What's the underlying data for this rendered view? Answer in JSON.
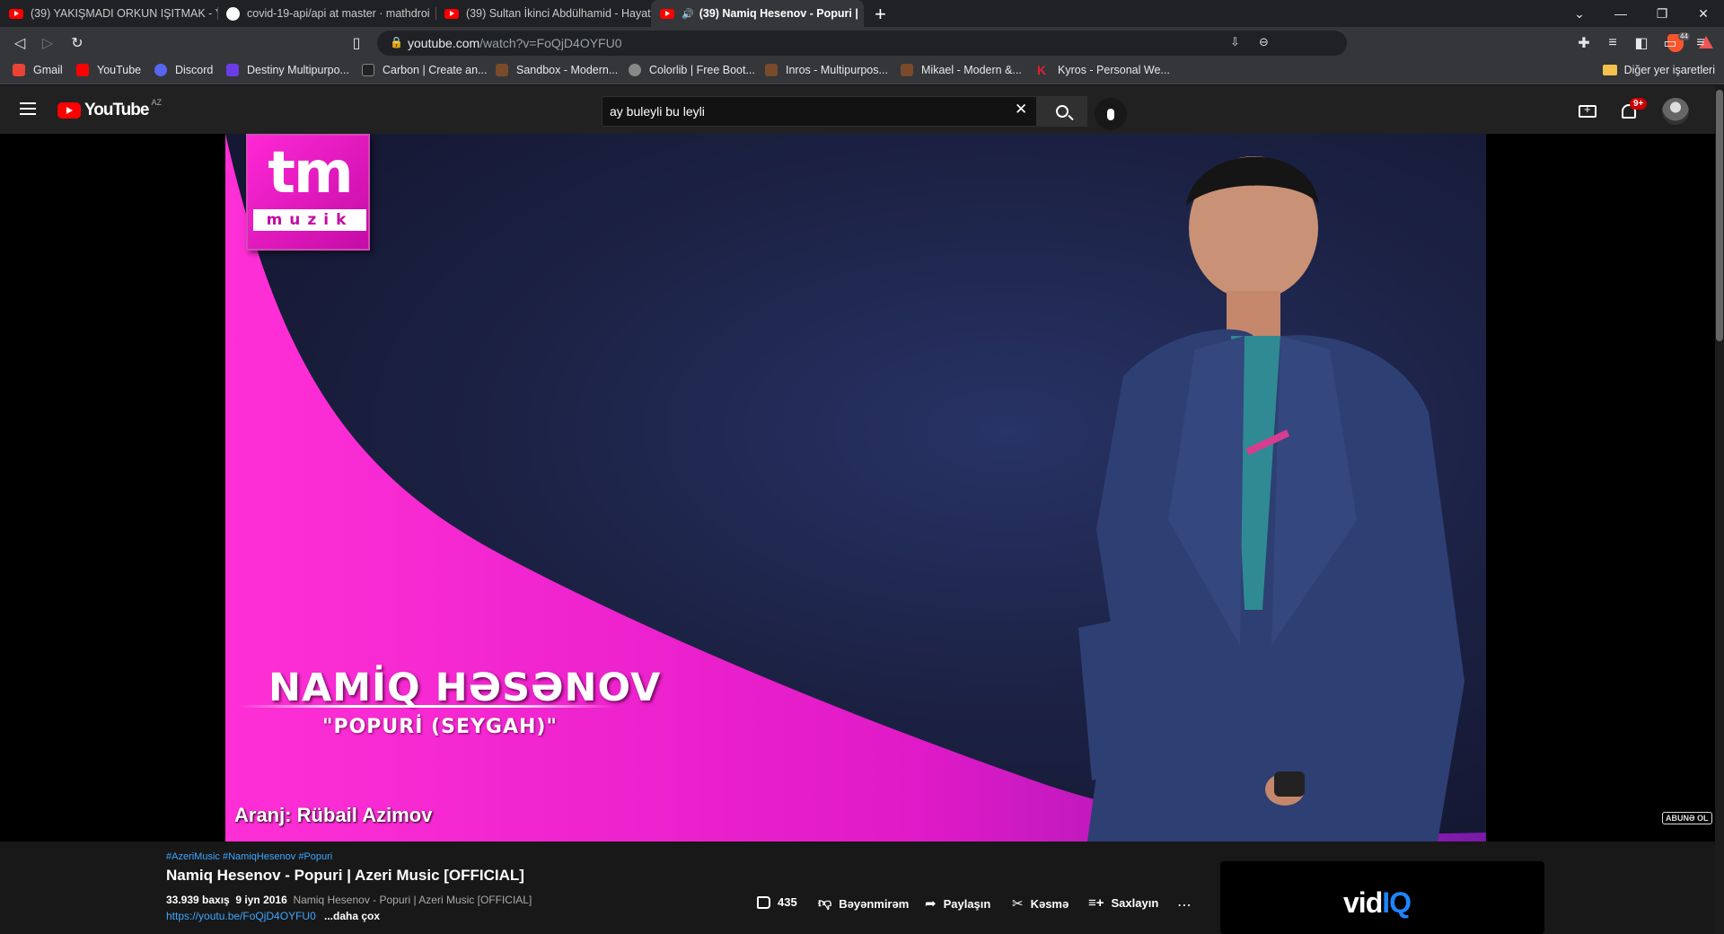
{
  "tabs": [
    {
      "label": "(39) YAKIŞMADI ORKUN IŞITMAK - Yo",
      "icon": "youtube-icon"
    },
    {
      "label": "covid-19-api/api at master · mathdroi",
      "icon": "github-icon"
    },
    {
      "label": "(39) Sultan İkinci Abdülhamid - Hayatı",
      "icon": "youtube-icon"
    },
    {
      "label": "(39) Namiq Hesenov - Popuri |",
      "icon": "youtube-icon",
      "active": true,
      "close": "✕"
    }
  ],
  "address_bar": {
    "host": "youtube.com",
    "path": "/watch?v=FoQjD4OYFU0"
  },
  "brave_badge": "44",
  "bookmarks": [
    {
      "label": "Gmail",
      "color": "#ea4335"
    },
    {
      "label": "YouTube",
      "color": "#ff0000"
    },
    {
      "label": "Discord",
      "color": "#5865f2"
    },
    {
      "label": "Destiny Multipurpo...",
      "color": "#6a3de8"
    },
    {
      "label": "Carbon | Create an...",
      "color": "#222222"
    },
    {
      "label": "Sandbox - Modern...",
      "color": "#7a4b2a"
    },
    {
      "label": "Colorlib | Free Boot...",
      "color": "#888888"
    },
    {
      "label": "Inros - Multipurpos...",
      "color": "#7a4b2a"
    },
    {
      "label": "Mikael - Modern &...",
      "color": "#7a4b2a"
    },
    {
      "label": "Kyros - Personal We...",
      "color": "#e0202f"
    }
  ],
  "bookmarks_other": "Diğer yer işaretleri",
  "youtube": {
    "logo_text": "YouTube",
    "region": "AZ",
    "search_value": "ay buleyli bu leyli",
    "notifications": "9+"
  },
  "video_overlay": {
    "logo_main": "tm",
    "logo_sub": "muzik",
    "artist": "NAMİQ HƏSƏNOV",
    "song": "\"POPURİ (SEYGAH)\"",
    "arranger": "Aranj: Rübail Azimov",
    "watermark": "ABUNƏ OL"
  },
  "video_info": {
    "hashtags": "#AzeriMusic #NamiqHesenov #Popuri",
    "title": "Namiq Hesenov - Popuri | Azeri Music [OFFICIAL]",
    "views": "33.939 baxış",
    "date": "9 iyn 2016",
    "description": "Namiq Hesenov - Popuri | Azeri Music [OFFICIAL]",
    "link": "https://youtu.be/FoQjD4OYFU0",
    "more": "...daha çox"
  },
  "actions": {
    "likes": "435",
    "dislike": "Bəyənmirəm",
    "share": "Paylaşın",
    "clip": "Kəsmə",
    "save": "Saxlayın"
  },
  "sidebar_ad": {
    "brand_a": "vid",
    "brand_b": "IQ"
  }
}
